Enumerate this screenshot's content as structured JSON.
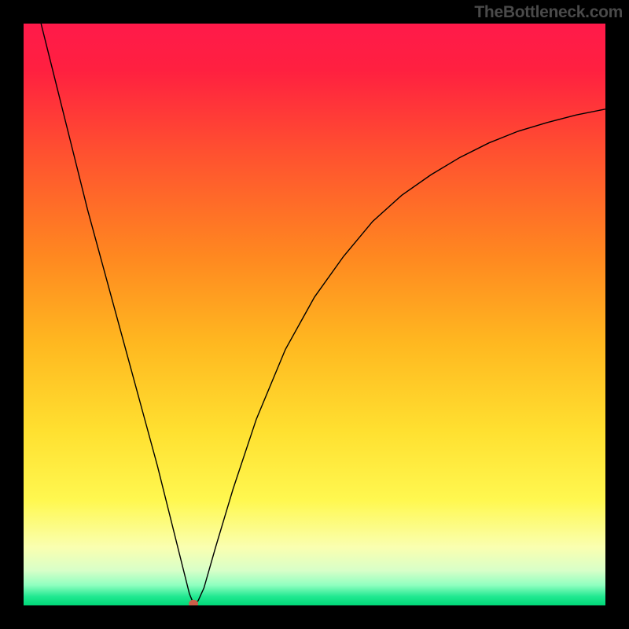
{
  "watermark": "TheBottleneck.com",
  "chart_data": {
    "type": "line",
    "title": "",
    "xlabel": "",
    "ylabel": "",
    "xlim": [
      0,
      100
    ],
    "ylim": [
      0,
      100
    ],
    "background_gradient": {
      "stops": [
        {
          "pos": 0.0,
          "color": "#ff1a4a"
        },
        {
          "pos": 0.08,
          "color": "#ff2040"
        },
        {
          "pos": 0.22,
          "color": "#ff5030"
        },
        {
          "pos": 0.4,
          "color": "#ff8820"
        },
        {
          "pos": 0.55,
          "color": "#ffb820"
        },
        {
          "pos": 0.7,
          "color": "#ffe030"
        },
        {
          "pos": 0.82,
          "color": "#fff850"
        },
        {
          "pos": 0.9,
          "color": "#faffb0"
        },
        {
          "pos": 0.94,
          "color": "#d8ffc8"
        },
        {
          "pos": 0.965,
          "color": "#90ffc0"
        },
        {
          "pos": 0.985,
          "color": "#20e890"
        },
        {
          "pos": 1.0,
          "color": "#00d878"
        }
      ]
    },
    "series": [
      {
        "name": "bottleneck-curve",
        "color": "#000000",
        "points": [
          {
            "x": 3,
            "y": 100
          },
          {
            "x": 5,
            "y": 92
          },
          {
            "x": 8,
            "y": 80
          },
          {
            "x": 11,
            "y": 68
          },
          {
            "x": 14,
            "y": 57
          },
          {
            "x": 17,
            "y": 46
          },
          {
            "x": 20,
            "y": 35
          },
          {
            "x": 23,
            "y": 24
          },
          {
            "x": 25,
            "y": 16
          },
          {
            "x": 27,
            "y": 8
          },
          {
            "x": 28.5,
            "y": 2
          },
          {
            "x": 29.2,
            "y": 0.3
          },
          {
            "x": 30,
            "y": 0.8
          },
          {
            "x": 31,
            "y": 3
          },
          {
            "x": 33,
            "y": 10
          },
          {
            "x": 36,
            "y": 20
          },
          {
            "x": 40,
            "y": 32
          },
          {
            "x": 45,
            "y": 44
          },
          {
            "x": 50,
            "y": 53
          },
          {
            "x": 55,
            "y": 60
          },
          {
            "x": 60,
            "y": 66
          },
          {
            "x": 65,
            "y": 70.5
          },
          {
            "x": 70,
            "y": 74
          },
          {
            "x": 75,
            "y": 77
          },
          {
            "x": 80,
            "y": 79.5
          },
          {
            "x": 85,
            "y": 81.5
          },
          {
            "x": 90,
            "y": 83
          },
          {
            "x": 95,
            "y": 84.3
          },
          {
            "x": 100,
            "y": 85.3
          }
        ]
      }
    ],
    "marker": {
      "x": 29.2,
      "y": 0.3,
      "color": "#cc5f4a",
      "rx": 6,
      "ry": 5
    }
  }
}
